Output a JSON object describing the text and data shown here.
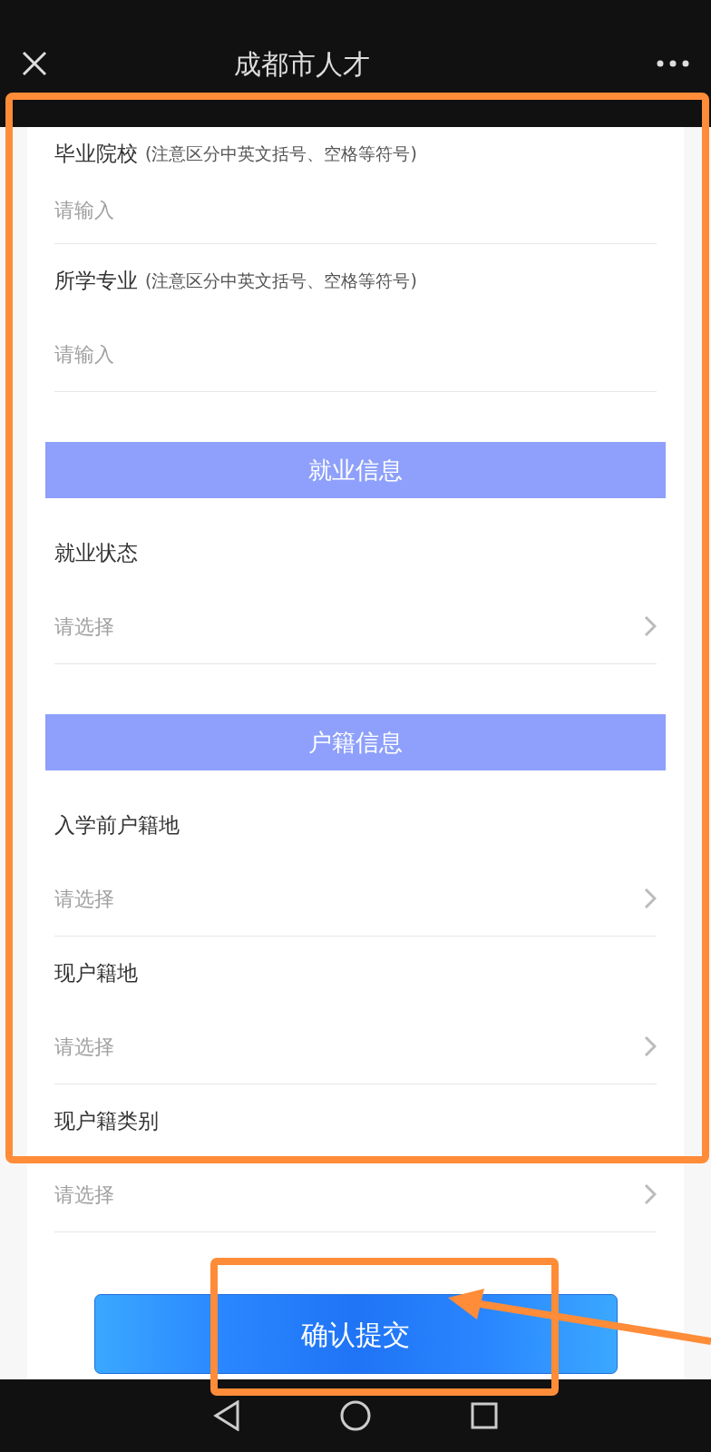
{
  "header": {
    "title": "成都市人才"
  },
  "items": [
    {
      "kind": "input",
      "label": "毕业院校",
      "note": "(注意区分中英文括号、空格等符号)",
      "placeholder": "请输入"
    },
    {
      "kind": "input",
      "label": "所学专业",
      "note": "(注意区分中英文括号、空格等符号)",
      "placeholder": "请输入"
    },
    {
      "kind": "section",
      "title": "就业信息"
    },
    {
      "kind": "select",
      "label": "就业状态",
      "placeholder": "请选择"
    },
    {
      "kind": "section",
      "title": "户籍信息"
    },
    {
      "kind": "select",
      "label": "入学前户籍地",
      "placeholder": "请选择"
    },
    {
      "kind": "select",
      "label": "现户籍地",
      "placeholder": "请选择"
    },
    {
      "kind": "select",
      "label": "现户籍类别",
      "placeholder": "请选择"
    }
  ],
  "submit": {
    "label": "确认提交"
  }
}
